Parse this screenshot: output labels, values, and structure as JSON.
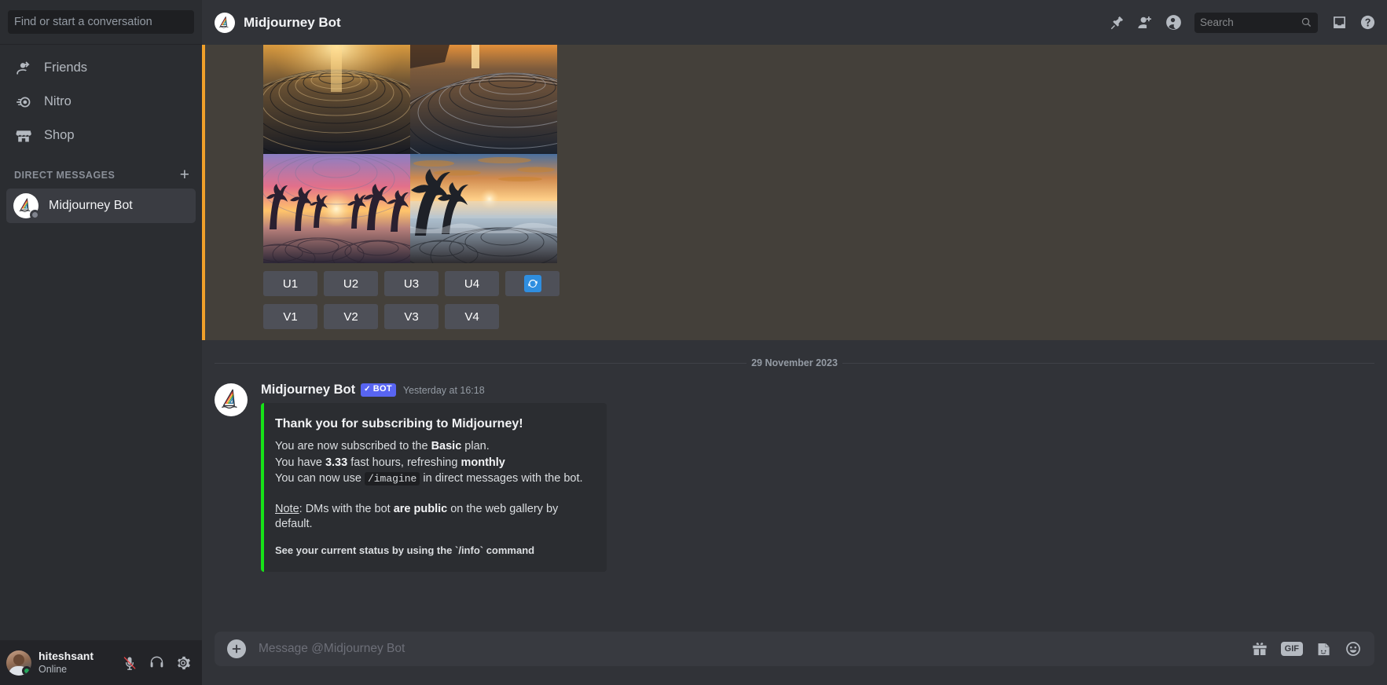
{
  "sidebar": {
    "search_placeholder": "Find or start a conversation",
    "nav": [
      {
        "label": "Friends",
        "icon": "friends-icon"
      },
      {
        "label": "Nitro",
        "icon": "nitro-icon"
      },
      {
        "label": "Shop",
        "icon": "shop-icon"
      }
    ],
    "dm_section_label": "DIRECT MESSAGES",
    "dm_add_label": "+",
    "dms": [
      {
        "name": "Midjourney Bot",
        "status": "idle"
      }
    ],
    "user": {
      "name": "hiteshsant",
      "status": "Online",
      "mic_icon": "microphone-muted-icon",
      "headset_icon": "headset-icon",
      "settings_icon": "gear-icon"
    }
  },
  "topbar": {
    "title": "Midjourney Bot",
    "search_placeholder": "Search",
    "icons": [
      "pin-icon",
      "add-friend-icon",
      "user-profile-icon",
      "search-icon",
      "inbox-icon",
      "help-icon"
    ]
  },
  "conversation": {
    "generation_message": {
      "highlighted": true,
      "accent_color": "#f0a02a",
      "images": [
        {
          "alt": "golden sunset over concentric rippled sand dunes"
        },
        {
          "alt": "sunset over dark rippled wave patterns"
        },
        {
          "alt": "palm tree silhouettes at sunset over rippled beach"
        },
        {
          "alt": "tropical beach sunset with palm trees and waves"
        }
      ],
      "upscale_buttons": [
        "U1",
        "U2",
        "U3",
        "U4"
      ],
      "variation_buttons": [
        "V1",
        "V2",
        "V3",
        "V4"
      ],
      "reroll_button": {
        "icon": "refresh-icon",
        "color": "#2f8ee0"
      }
    },
    "date_divider": "29 November 2023",
    "message": {
      "author": "Midjourney Bot",
      "bot_tag": "BOT",
      "bot_tag_check": "✓",
      "timestamp": "Yesterday at 16:18",
      "embed": {
        "accent_color": "#17e218",
        "title": "Thank you for subscribing to Midjourney!",
        "line1_a": "You are now subscribed to the ",
        "line1_b": "Basic",
        "line1_c": " plan.",
        "line2_a": "You have ",
        "line2_b": "3.33",
        "line2_c": " fast hours, refreshing ",
        "line2_d": "monthly",
        "line3_a": "You can now use ",
        "line3_code": "/imagine",
        "line3_c": " in direct messages with the bot.",
        "note_label": "Note",
        "note_a": ": DMs with the bot ",
        "note_b": "are public",
        "note_c": " on the web gallery by default.",
        "footer": "See your current status by using the `/info` command"
      }
    }
  },
  "composer": {
    "placeholder": "Message @Midjourney Bot",
    "attach_icon": "plus-circle-icon",
    "icons": [
      {
        "name": "gift-icon"
      },
      {
        "name": "gif-icon",
        "label": "GIF"
      },
      {
        "name": "sticker-icon"
      },
      {
        "name": "emoji-icon"
      }
    ]
  }
}
